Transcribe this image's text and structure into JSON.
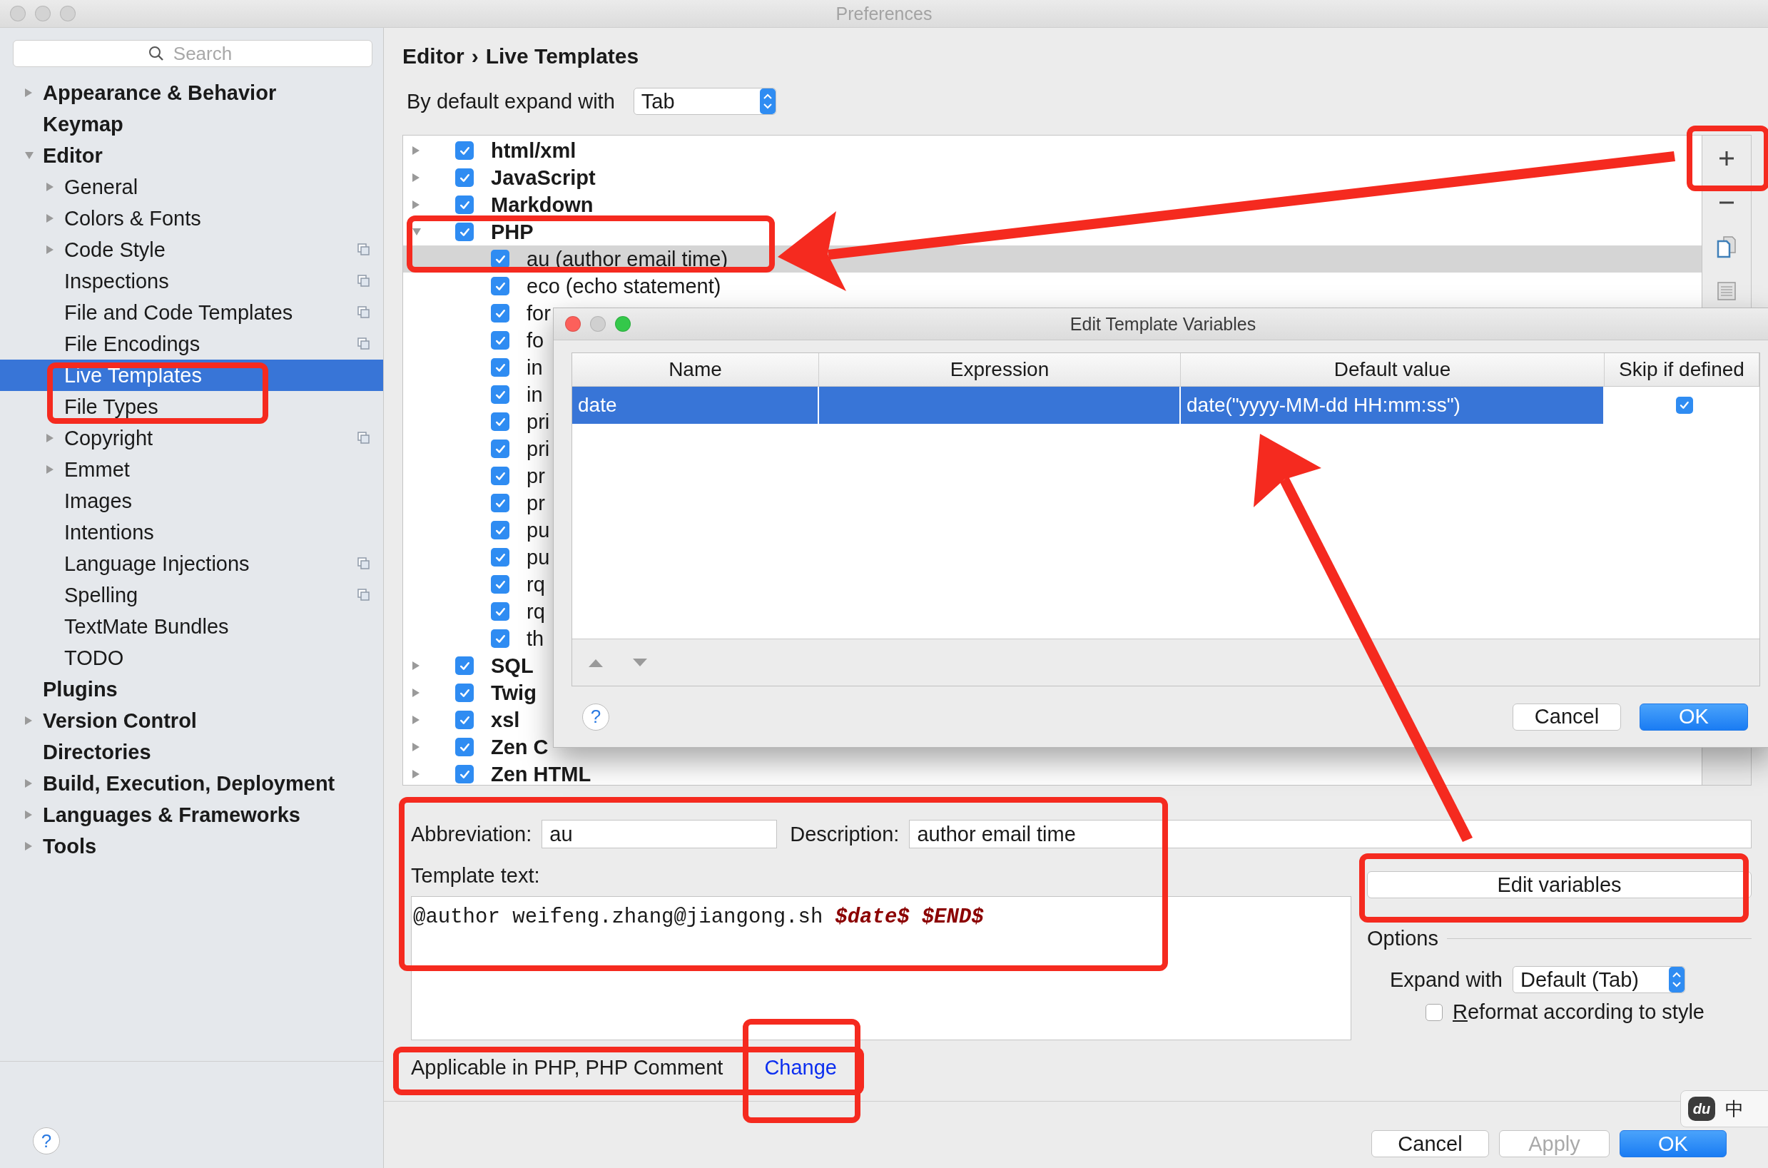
{
  "window": {
    "title": "Preferences"
  },
  "sidebar": {
    "search": {
      "placeholder": "Search"
    },
    "items": [
      {
        "label": "Appearance & Behavior",
        "expandable": true,
        "expanded": false,
        "selected": false,
        "scoped": false
      },
      {
        "label": "Keymap",
        "expandable": false,
        "selected": false,
        "scoped": false
      },
      {
        "label": "Editor",
        "expandable": true,
        "expanded": true,
        "selected": false,
        "scoped": false,
        "children": [
          {
            "label": "General",
            "expandable": true,
            "expanded": false,
            "selected": false,
            "scoped": false
          },
          {
            "label": "Colors & Fonts",
            "expandable": true,
            "expanded": false,
            "selected": false,
            "scoped": false
          },
          {
            "label": "Code Style",
            "expandable": true,
            "expanded": false,
            "selected": false,
            "scoped": true
          },
          {
            "label": "Inspections",
            "expandable": false,
            "selected": false,
            "scoped": true
          },
          {
            "label": "File and Code Templates",
            "expandable": false,
            "selected": false,
            "scoped": true
          },
          {
            "label": "File Encodings",
            "expandable": false,
            "selected": false,
            "scoped": true
          },
          {
            "label": "Live Templates",
            "expandable": false,
            "selected": true,
            "scoped": false
          },
          {
            "label": "File Types",
            "expandable": false,
            "selected": false,
            "scoped": false
          },
          {
            "label": "Copyright",
            "expandable": true,
            "expanded": false,
            "selected": false,
            "scoped": true
          },
          {
            "label": "Emmet",
            "expandable": true,
            "expanded": false,
            "selected": false,
            "scoped": false
          },
          {
            "label": "Images",
            "expandable": false,
            "selected": false,
            "scoped": false
          },
          {
            "label": "Intentions",
            "expandable": false,
            "selected": false,
            "scoped": false
          },
          {
            "label": "Language Injections",
            "expandable": false,
            "selected": false,
            "scoped": true
          },
          {
            "label": "Spelling",
            "expandable": false,
            "selected": false,
            "scoped": true
          },
          {
            "label": "TextMate Bundles",
            "expandable": false,
            "selected": false,
            "scoped": false
          },
          {
            "label": "TODO",
            "expandable": false,
            "selected": false,
            "scoped": false
          }
        ]
      },
      {
        "label": "Plugins",
        "expandable": false,
        "selected": false,
        "scoped": false
      },
      {
        "label": "Version Control",
        "expandable": true,
        "expanded": false,
        "selected": false,
        "scoped": false
      },
      {
        "label": "Directories",
        "expandable": false,
        "selected": false,
        "scoped": false
      },
      {
        "label": "Build, Execution, Deployment",
        "expandable": true,
        "expanded": false,
        "selected": false,
        "scoped": false
      },
      {
        "label": "Languages & Frameworks",
        "expandable": true,
        "expanded": false,
        "selected": false,
        "scoped": false
      },
      {
        "label": "Tools",
        "expandable": true,
        "expanded": false,
        "selected": false,
        "scoped": false
      }
    ],
    "help": "?"
  },
  "breadcrumb": {
    "items": [
      "Editor",
      "Live Templates"
    ],
    "separator": "›"
  },
  "expand_default": {
    "label": "By default expand with",
    "value": "Tab"
  },
  "template_groups": [
    {
      "label": "html/xml",
      "checked": true,
      "expanded": false,
      "selected": false
    },
    {
      "label": "JavaScript",
      "checked": true,
      "expanded": false,
      "selected": false
    },
    {
      "label": "Markdown",
      "checked": true,
      "expanded": false,
      "selected": false
    },
    {
      "label": "PHP",
      "checked": true,
      "expanded": true,
      "selected": false,
      "children": [
        {
          "label": "au (author email time)",
          "checked": true,
          "selected": true
        },
        {
          "label": "eco (echo statement)",
          "checked": true,
          "selected": false
        },
        {
          "label": "for",
          "checked": true,
          "selected": false
        },
        {
          "label": "fo",
          "checked": true,
          "selected": false
        },
        {
          "label": "in",
          "checked": true,
          "selected": false
        },
        {
          "label": "in",
          "checked": true,
          "selected": false
        },
        {
          "label": "pri",
          "checked": true,
          "selected": false
        },
        {
          "label": "pri",
          "checked": true,
          "selected": false
        },
        {
          "label": "pr",
          "checked": true,
          "selected": false
        },
        {
          "label": "pr",
          "checked": true,
          "selected": false
        },
        {
          "label": "pu",
          "checked": true,
          "selected": false
        },
        {
          "label": "pu",
          "checked": true,
          "selected": false
        },
        {
          "label": "rq",
          "checked": true,
          "selected": false
        },
        {
          "label": "rq",
          "checked": true,
          "selected": false
        },
        {
          "label": "th",
          "checked": true,
          "selected": false
        }
      ]
    },
    {
      "label": "SQL",
      "checked": true,
      "expanded": false,
      "selected": false
    },
    {
      "label": "Twig",
      "checked": true,
      "expanded": false,
      "selected": false
    },
    {
      "label": "xsl",
      "checked": true,
      "expanded": false,
      "selected": false
    },
    {
      "label": "Zen C",
      "checked": true,
      "expanded": false,
      "selected": false
    },
    {
      "label": "Zen HTML",
      "checked": true,
      "expanded": false,
      "selected": false
    }
  ],
  "editor": {
    "abbreviation": {
      "label": "Abbreviation:",
      "value": "au"
    },
    "description": {
      "label": "Description:",
      "value": "author email time"
    },
    "template_text": {
      "label": "Template text:",
      "segments": [
        {
          "kind": "plain",
          "text": "@author weifeng.zhang@jiangong.sh"
        },
        {
          "kind": "variable",
          "text": "$date$"
        },
        {
          "kind": "variable",
          "text": "$END$"
        }
      ]
    },
    "edit_variables": "Edit variables",
    "options": {
      "title": "Options",
      "expand_with": {
        "label": "Expand with",
        "value": "Default (Tab)"
      },
      "reformat": {
        "label": "Reformat according to style",
        "checked": false
      }
    },
    "context": {
      "text": "Applicable in PHP, PHP Comment",
      "link": "Change"
    }
  },
  "footer": {
    "buttons": [
      {
        "label": "Cancel",
        "kind": "default"
      },
      {
        "label": "Apply",
        "kind": "disabled"
      },
      {
        "label": "OK",
        "kind": "primary"
      }
    ]
  },
  "ime": {
    "logo": "du",
    "label": "中"
  },
  "dialog": {
    "title": "Edit Template Variables",
    "columns": [
      "Name",
      "Expression",
      "Default value",
      "Skip if defined"
    ],
    "rows": [
      {
        "name": "date",
        "default_value": "date(\"yyyy-MM-dd HH:mm:ss\")",
        "skip_if_defined": true,
        "selected": true
      }
    ],
    "help": "?",
    "buttons": [
      {
        "label": "Cancel",
        "kind": "default"
      },
      {
        "label": "OK",
        "kind": "primary"
      }
    ]
  }
}
